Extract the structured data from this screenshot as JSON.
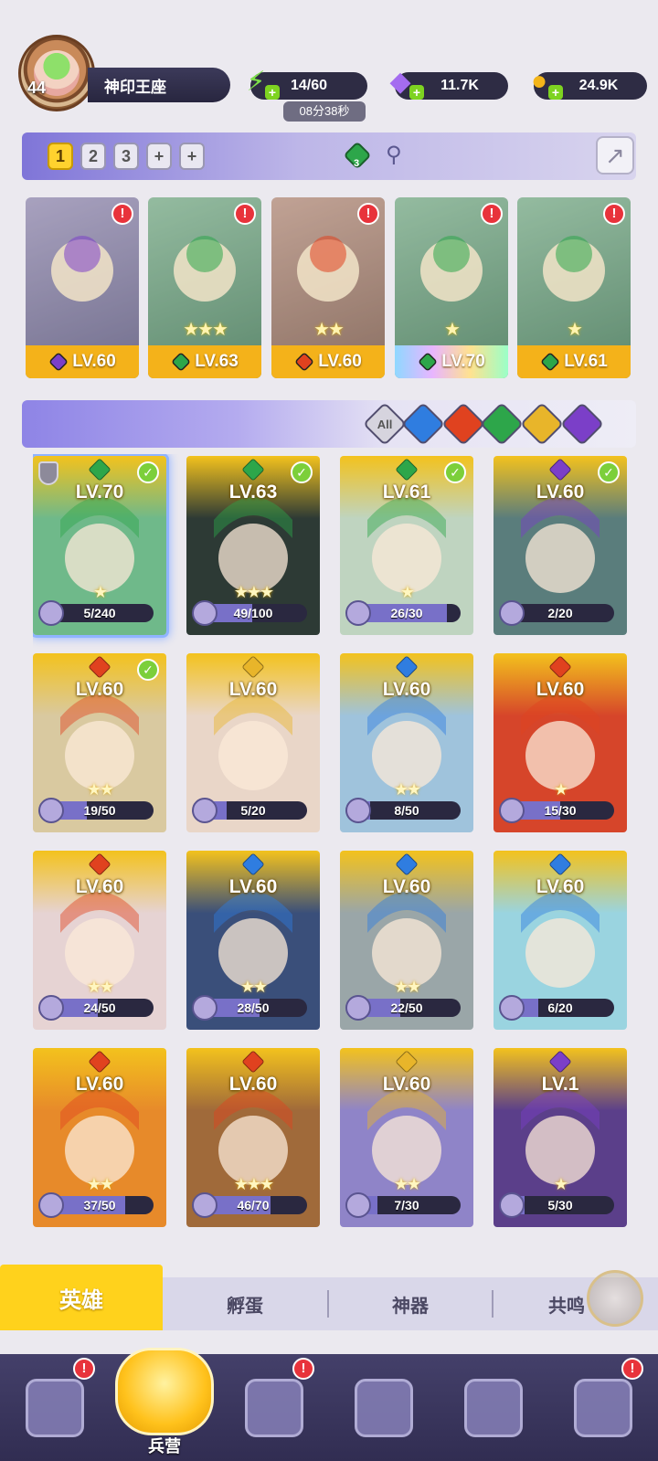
{
  "player": {
    "level": "44",
    "name": "神印王座"
  },
  "resources": {
    "energy": {
      "value": "14/60",
      "timer": "08分38秒",
      "icon": "lightning-icon"
    },
    "gems": {
      "value": "11.7K",
      "icon": "gem-icon"
    },
    "gold": {
      "value": "24.9K",
      "icon": "coin-icon"
    }
  },
  "team_tabs": [
    "1",
    "2",
    "3",
    "+",
    "+"
  ],
  "team_element_count": "3",
  "team_slots": [
    {
      "level": "LV.60",
      "element": "dark",
      "stars": "",
      "alert": true,
      "color": "#7b3fc8"
    },
    {
      "level": "LV.63",
      "element": "wind",
      "stars": "★★★",
      "alert": true,
      "color": "#2da64a"
    },
    {
      "level": "LV.60",
      "element": "fire",
      "stars": "★★",
      "alert": true,
      "color": "#e0421f"
    },
    {
      "level": "LV.70",
      "element": "wind",
      "stars": "★",
      "alert": true,
      "color": "#2da64a"
    },
    {
      "level": "LV.61",
      "element": "wind",
      "stars": "★",
      "alert": true,
      "color": "#2da64a"
    }
  ],
  "filters": [
    {
      "label": "All",
      "color": "#d6d4de",
      "icon": "all-filter-icon"
    },
    {
      "label": "",
      "color": "#2f7de0",
      "icon": "water-element-icon"
    },
    {
      "label": "",
      "color": "#e0421f",
      "icon": "fire-element-icon"
    },
    {
      "label": "",
      "color": "#2da64a",
      "icon": "wind-element-icon"
    },
    {
      "label": "",
      "color": "#e8b52a",
      "icon": "light-element-icon"
    },
    {
      "label": "",
      "color": "#7b3fc8",
      "icon": "dark-element-icon"
    }
  ],
  "heroes": [
    {
      "level": "LV.70",
      "progress": "5/240",
      "fill": 0.02,
      "element": "#2da64a",
      "check": true,
      "shield": true,
      "stars": "★",
      "bg": "#6fb98a"
    },
    {
      "level": "LV.63",
      "progress": "49/100",
      "fill": 0.49,
      "element": "#2da64a",
      "check": true,
      "shield": false,
      "stars": "★★★",
      "bg": "#2d3a35"
    },
    {
      "level": "LV.61",
      "progress": "26/30",
      "fill": 0.87,
      "element": "#2da64a",
      "check": true,
      "shield": false,
      "stars": "★",
      "bg": "#bfd4c0"
    },
    {
      "level": "LV.60",
      "progress": "2/20",
      "fill": 0.1,
      "element": "#7b3fc8",
      "check": true,
      "shield": false,
      "stars": "",
      "bg": "#5a7d7c"
    },
    {
      "level": "LV.60",
      "progress": "19/50",
      "fill": 0.38,
      "element": "#e0421f",
      "check": true,
      "shield": false,
      "stars": "★★",
      "bg": "#d9c9a0"
    },
    {
      "level": "LV.60",
      "progress": "5/20",
      "fill": 0.25,
      "element": "#e8b52a",
      "check": false,
      "shield": false,
      "stars": "",
      "bg": "#e9d6c8"
    },
    {
      "level": "LV.60",
      "progress": "8/50",
      "fill": 0.16,
      "element": "#2f7de0",
      "check": false,
      "shield": false,
      "stars": "★★",
      "bg": "#9fc3dc"
    },
    {
      "level": "LV.60",
      "progress": "15/30",
      "fill": 0.5,
      "element": "#e0421f",
      "check": false,
      "shield": false,
      "stars": "★",
      "bg": "#d6452a"
    },
    {
      "level": "LV.60",
      "progress": "24/50",
      "fill": 0.48,
      "element": "#e0421f",
      "check": false,
      "shield": false,
      "stars": "★★",
      "bg": "#e6d3d3"
    },
    {
      "level": "LV.60",
      "progress": "28/50",
      "fill": 0.56,
      "element": "#2f7de0",
      "check": false,
      "shield": false,
      "stars": "★★",
      "bg": "#3a4f7a"
    },
    {
      "level": "LV.60",
      "progress": "22/50",
      "fill": 0.44,
      "element": "#2f7de0",
      "check": false,
      "shield": false,
      "stars": "★★",
      "bg": "#9aa6a8"
    },
    {
      "level": "LV.60",
      "progress": "6/20",
      "fill": 0.3,
      "element": "#2f7de0",
      "check": false,
      "shield": false,
      "stars": "",
      "bg": "#9ad4e0"
    },
    {
      "level": "LV.60",
      "progress": "37/50",
      "fill": 0.74,
      "element": "#e0421f",
      "check": false,
      "shield": false,
      "stars": "★★",
      "bg": "#e78a2a"
    },
    {
      "level": "LV.60",
      "progress": "46/70",
      "fill": 0.66,
      "element": "#e0421f",
      "check": false,
      "shield": false,
      "stars": "★★★",
      "bg": "#a06a3a"
    },
    {
      "level": "LV.60",
      "progress": "7/30",
      "fill": 0.23,
      "element": "#e8b52a",
      "check": false,
      "shield": false,
      "stars": "★★",
      "bg": "#8f84c8"
    },
    {
      "level": "LV.1",
      "progress": "5/30",
      "fill": 0.17,
      "element": "#7b3fc8",
      "check": false,
      "shield": false,
      "stars": "★",
      "bg": "#5b3f8a"
    }
  ],
  "sub_tabs": [
    "英雄",
    "孵蛋",
    "神器",
    "共鸣"
  ],
  "bottom_nav": [
    {
      "label": "",
      "icon": "cards-icon",
      "alert": true
    },
    {
      "label": "兵营",
      "icon": "barracks-icon",
      "alert": false,
      "active": true
    },
    {
      "label": "",
      "icon": "map-icon",
      "alert": true
    },
    {
      "label": "",
      "icon": "castle-icon",
      "alert": false
    },
    {
      "label": "",
      "icon": "mushroom-icon",
      "alert": false
    },
    {
      "label": "",
      "icon": "banner-icon",
      "alert": true
    }
  ],
  "alert_glyph": "!"
}
